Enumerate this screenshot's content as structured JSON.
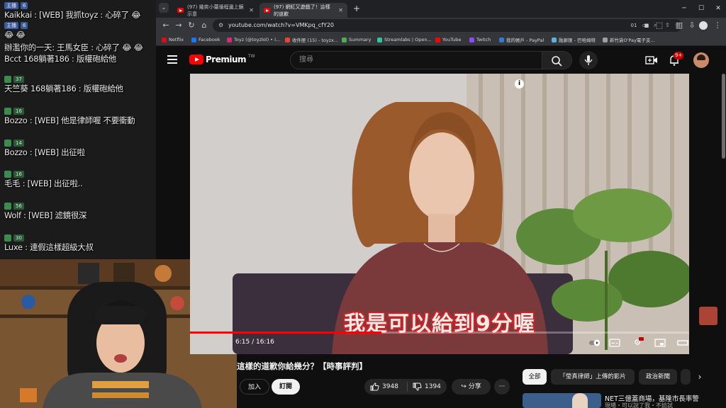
{
  "chat": {
    "items": [
      {
        "badge": "主播",
        "badge_count": "6",
        "text": "Kaikkai : [WEB] 我抓toyz : 心碎了 😂"
      },
      {
        "badge": "主播",
        "badge_count": "6",
        "text": "😂 😂"
      },
      {
        "badge": "",
        "badge_count": "",
        "text": "辦濫你的一天: 王馬女臣 : 心碎了 😂 😂"
      },
      {
        "badge": "",
        "badge_count": "",
        "text": "Bcct 168躺著186 : 版權砲給他"
      },
      {
        "badge": "37",
        "badge_count": "",
        "text": "天竺葵 168躺著186 : 版權砲給他"
      },
      {
        "badge": "16",
        "badge_count": "",
        "text": "Bozzo : [WEB] 他是律師喔 不要衝動"
      },
      {
        "badge": "14",
        "badge_count": "",
        "text": "Bozzo : [WEB] 出征啦"
      },
      {
        "badge": "16",
        "badge_count": "",
        "text": "毛毛 : [WEB] 出征啦.."
      },
      {
        "badge": "56",
        "badge_count": "",
        "text": "Wolf : [WEB] 滤鏡很深"
      },
      {
        "badge": "30",
        "badge_count": "",
        "text": "Luxe : 連假這樣超級大叔"
      }
    ]
  },
  "tabs": [
    {
      "label": "(97) 幾奕小蕾循程邊上鏡示意",
      "active": false
    },
    {
      "label": "(97) 網紅又遊戲了！這樣的道歉",
      "active": true
    }
  ],
  "tab_new": "+",
  "window": {
    "min": "─",
    "max": "☐",
    "close": "✕"
  },
  "address": {
    "url": "youtube.com/watch?v=VMKpq_cfY20"
  },
  "bookmarks": [
    {
      "label": "Netflix",
      "color": "#e50914"
    },
    {
      "label": "Facebook",
      "color": "#1877f2"
    },
    {
      "label": "Toyz (@toyzlol) • I...",
      "color": "#d62976"
    },
    {
      "label": "收件匣 (15) - toyzx...",
      "color": "#ea4335"
    },
    {
      "label": "Summary",
      "color": "#4caf50"
    },
    {
      "label": "Streamlabs | Open...",
      "color": "#31c3a2"
    },
    {
      "label": "YouTube",
      "color": "#ff0000"
    },
    {
      "label": "Twitch",
      "color": "#9146ff"
    },
    {
      "label": "我的帳戶 - PayPal",
      "color": "#2d7bd6"
    },
    {
      "label": "融廊匯 - 巴哈姆特",
      "color": "#5ab0e0"
    },
    {
      "label": "新竹貨O'Pay電子支...",
      "color": "#9aa0a6"
    }
  ],
  "youtube": {
    "logo_text": "Premium",
    "logo_region": "TW",
    "search_placeholder": "搜尋",
    "notification_count": "9+"
  },
  "video": {
    "subtitle": "我是可以給到9分喔",
    "current_time": "6:15",
    "duration": "16:16",
    "timecode": "6:15 / 16:16",
    "progress": 0.384,
    "info": "i"
  },
  "meta": {
    "title": "這樣的道歉你給幾分？【時事評判】",
    "join": "加入",
    "subscribe": "訂閱",
    "likes": "3948",
    "dislikes": "1394",
    "share": "分享",
    "more": "···"
  },
  "chips": [
    {
      "label": "全部",
      "selected": true
    },
    {
      "label": "「瑩真律師」上傳的影片",
      "selected": false
    },
    {
      "label": "政治新聞",
      "selected": false
    }
  ],
  "chip_next": "›",
  "recommendation": {
    "title": "NET三億蓋商場，基隆市長率警",
    "meta": "現場・可以說了我・不妨試"
  }
}
